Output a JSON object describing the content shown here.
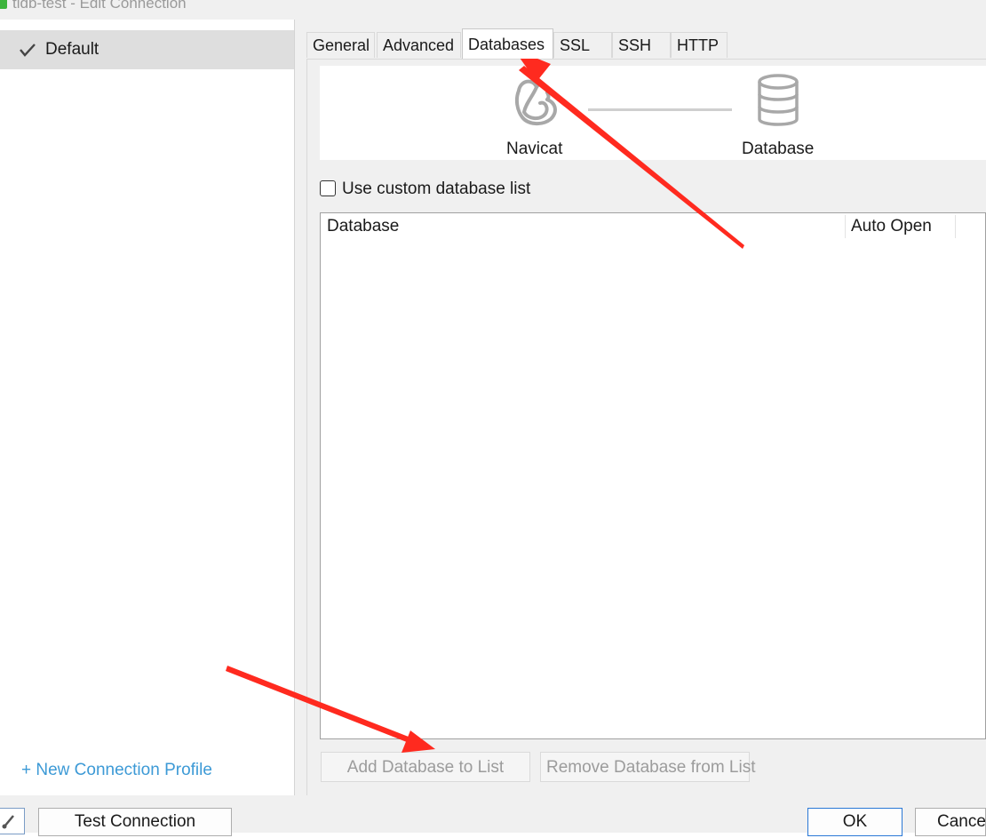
{
  "window": {
    "title": "tidb-test - Edit Connection"
  },
  "sidebar": {
    "items": [
      {
        "label": "Default",
        "selected": true
      }
    ],
    "new_profile_label": "+ New Connection Profile"
  },
  "tabs": [
    {
      "label": "General"
    },
    {
      "label": "Advanced"
    },
    {
      "label": "Databases",
      "active": true
    },
    {
      "label": "SSL"
    },
    {
      "label": "SSH"
    },
    {
      "label": "HTTP"
    }
  ],
  "diagram": {
    "left_label": "Navicat",
    "right_label": "Database",
    "left_icon": "navicat-logo-icon",
    "right_icon": "database-cylinder-icon"
  },
  "custom_list": {
    "label": "Use custom database list",
    "checked": false
  },
  "table": {
    "columns": [
      "Database",
      "Auto Open"
    ],
    "rows": []
  },
  "panel_buttons": {
    "add": "Add Database to List",
    "remove": "Remove Database from List"
  },
  "footer": {
    "test_connection": "Test Connection",
    "ok": "OK",
    "cancel": "Cancel"
  },
  "annotations": {
    "arrow_color": "#ff2a1f"
  },
  "colors": {
    "link": "#3d9ad6",
    "selected_bg": "#dedede",
    "disabled_text": "#9c9c9c"
  }
}
